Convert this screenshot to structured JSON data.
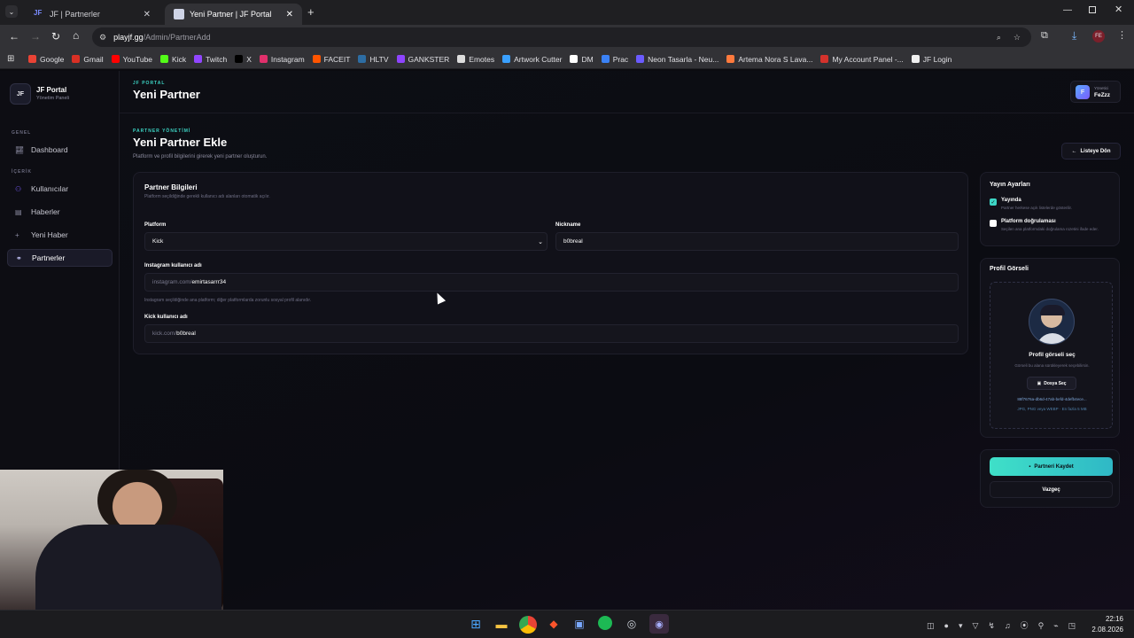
{
  "browser": {
    "tabs": [
      {
        "title": "JF | Partnerler"
      },
      {
        "title": "Yeni Partner | JF Portal"
      }
    ],
    "url_domain": "playjf.gg",
    "url_path": "/Admin/PartnerAdd",
    "bookmarks": [
      {
        "label": "Google",
        "color": "#ea4335"
      },
      {
        "label": "Gmail",
        "color": "#d93025"
      },
      {
        "label": "YouTube",
        "color": "#ff0000"
      },
      {
        "label": "Kick",
        "color": "#53fc18"
      },
      {
        "label": "Twitch",
        "color": "#9146ff"
      },
      {
        "label": "X",
        "color": "#000000"
      },
      {
        "label": "Instagram",
        "color": "#e1306c"
      },
      {
        "label": "FACEIT",
        "color": "#ff5500"
      },
      {
        "label": "HLTV",
        "color": "#2d6da3"
      },
      {
        "label": "GANKSTER",
        "color": "#8e44ff"
      },
      {
        "label": "Emotes",
        "color": "#dddddd"
      },
      {
        "label": "Artwork Cutter",
        "color": "#3aa0ff"
      },
      {
        "label": "DM",
        "color": "#ffffff"
      },
      {
        "label": "Prac",
        "color": "#3b82f6"
      },
      {
        "label": "Neon Tasarla - Neu...",
        "color": "#6b5bff"
      },
      {
        "label": "Artema Nora S Lava...",
        "color": "#ff7a3d"
      },
      {
        "label": "My Account Panel -...",
        "color": "#d4322c"
      },
      {
        "label": "JF Login",
        "color": "#f0f0f0"
      }
    ]
  },
  "sidebar": {
    "logo": "JF",
    "brand": "JF Portal",
    "subtitle": "Yönetim Paneli",
    "sections": [
      {
        "title": "GENEL",
        "items": [
          {
            "label": "Dashboard"
          }
        ]
      },
      {
        "title": "İÇERİK",
        "items": [
          {
            "label": "Kullanıcılar"
          },
          {
            "label": "Haberler"
          },
          {
            "label": "Yeni Haber"
          },
          {
            "label": "Partnerler"
          }
        ]
      }
    ]
  },
  "header": {
    "eyebrow": "JF PORTAL",
    "title": "Yeni Partner",
    "user_initial": "F",
    "user_role": "Yönetici",
    "user_name": "FeZzz"
  },
  "page": {
    "eyebrow": "PARTNER YÖNETİMİ",
    "title": "Yeni Partner Ekle",
    "description": "Platform ve profil bilgilerini girerek yeni partner oluşturun.",
    "back_button": "Listeye Dön"
  },
  "form": {
    "card_title": "Partner Bilgileri",
    "card_subtitle": "Platform seçildiğinde gerekli kullanıcı adı alanları otomatik açılır.",
    "platform_label": "Platform",
    "platform_value": "Kick",
    "nickname_label": "Nickname",
    "nickname_value": "b0breal",
    "instagram_label": "Instagram kullanıcı adı",
    "instagram_prefix": "instagram.com/",
    "instagram_value": "emirtasarrr34",
    "instagram_hint": "Instagram seçildiğinde ana platform; diğer platformlarda zorunlu sosyal profil alanıdır.",
    "kick_label": "Kick kullanıcı adı",
    "kick_prefix": "kick.com/",
    "kick_value": "b0breal"
  },
  "publish": {
    "title": "Yayın Ayarları",
    "published_label": "Yayında",
    "published_checked": true,
    "published_desc": "Partner herkese açık listelerde gösterilir.",
    "verified_label": "Platform doğrulaması",
    "verified_checked": false,
    "verified_desc": "Seçilen ana platformdaki doğrulama rozetini ifade eder."
  },
  "image": {
    "title": "Profil Görseli",
    "choose_label": "Profil görseli seç",
    "choose_desc": "Görseli bu alana sürükleyerek seçebilirsin.",
    "file_button": "Dosya Seç",
    "file_name": "88f7676a-db6d-47ab-befd-4defb4ece...",
    "file_hint": "JPG, PNG veya WEBP · En fazla 5 MB"
  },
  "actions": {
    "save": "Partneri Kaydet",
    "cancel": "Vazgeç"
  },
  "taskbar": {
    "time": "22:16",
    "date": "2.08.2026"
  },
  "colors": {
    "accent": "#3dd6c6",
    "accent_grad_end": "#2fb8c6",
    "bg": "#0b0c12"
  }
}
